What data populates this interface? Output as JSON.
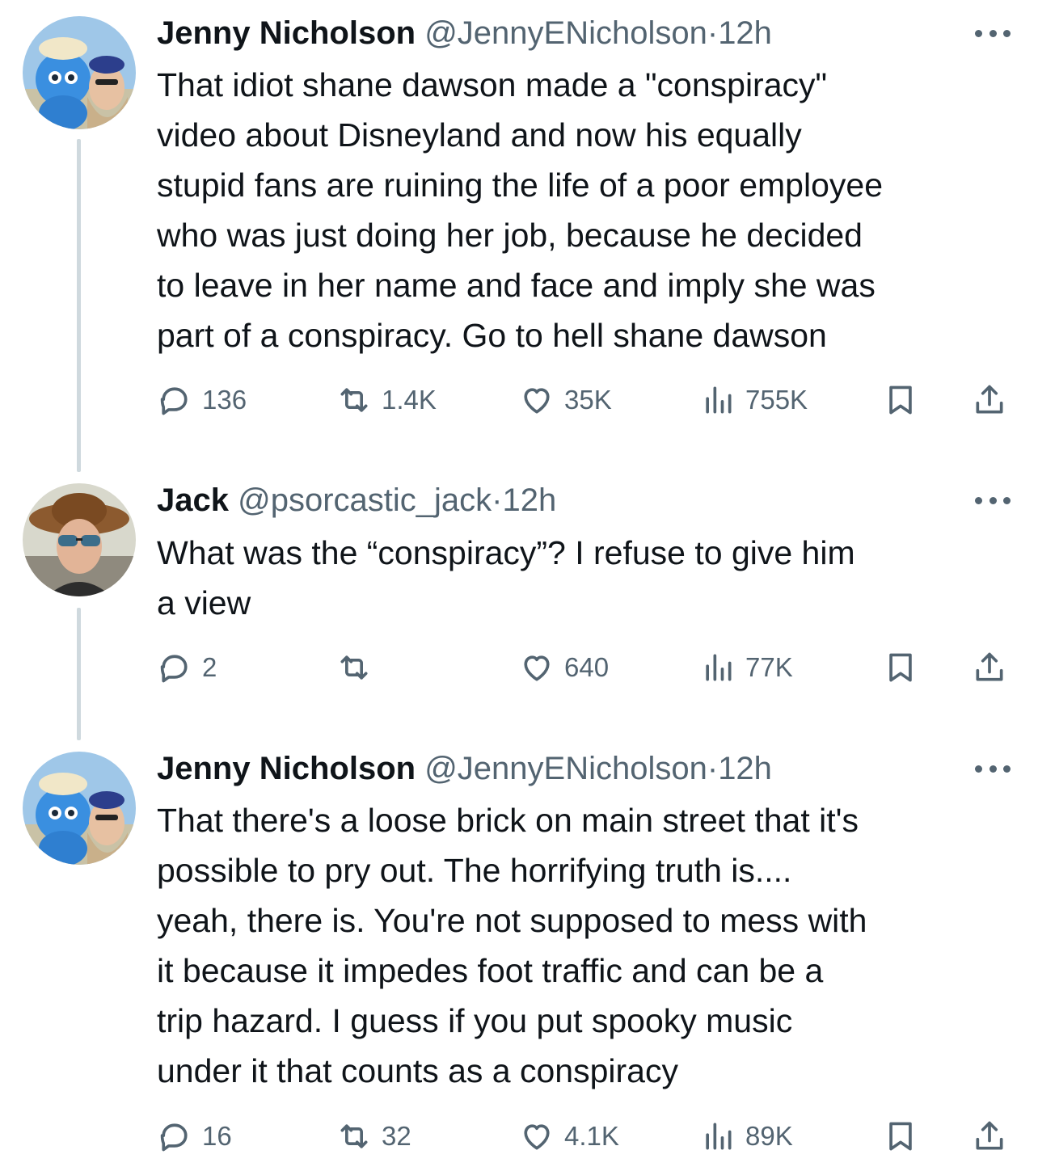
{
  "tweets": [
    {
      "name": "Jenny Nicholson",
      "handle": "@JennyENicholson",
      "dot": "·",
      "time": "12h",
      "text": "That idiot shane dawson made a \"conspiracy\"\nvideo about Disneyland and now his equally\nstupid fans are ruining the life of a poor employee\nwho was just doing her job, because he decided\nto leave in her name and face and imply she was\npart of a conspiracy. Go to hell shane dawson",
      "replies": "136",
      "retweets": "1.4K",
      "likes": "35K",
      "views": "755K"
    },
    {
      "name": "Jack",
      "handle": "@psorcastic_jack",
      "dot": "·",
      "time": "12h",
      "text": "What was the “conspiracy”? I refuse to give him\na view",
      "replies": "2",
      "retweets": "",
      "likes": "640",
      "views": "77K"
    },
    {
      "name": "Jenny Nicholson",
      "handle": "@JennyENicholson",
      "dot": "·",
      "time": "12h",
      "text": "That there's a loose brick on main street that it's\npossible to pry out. The horrifying truth is....\nyeah, there is. You're not supposed to mess with\nit because it impedes foot traffic and can be a\ntrip hazard. I guess if you put spooky music\nunder it that counts as a conspiracy",
      "replies": "16",
      "retweets": "32",
      "likes": "4.1K",
      "views": "89K"
    }
  ],
  "icons": {
    "reply": "reply-icon",
    "retweet": "retweet-icon",
    "like": "heart-icon",
    "views": "views-icon",
    "bookmark": "bookmark-icon",
    "share": "share-icon",
    "more": "more-icon"
  },
  "colors": {
    "text": "#0f1419",
    "secondary": "#536471",
    "thread_line": "#cfd9de"
  }
}
